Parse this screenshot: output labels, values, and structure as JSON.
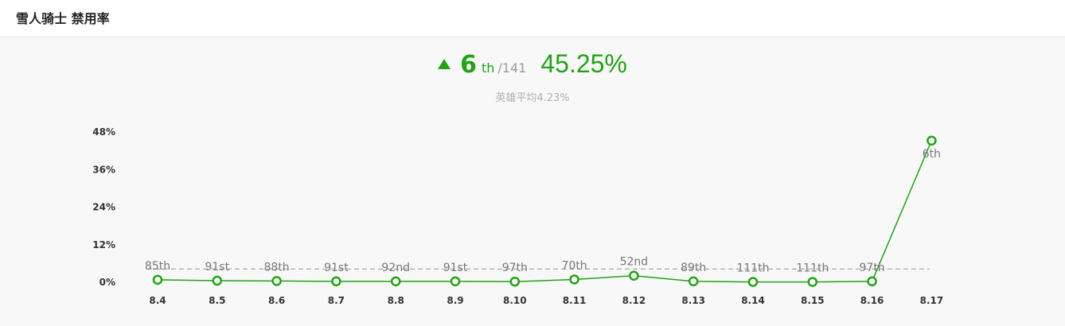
{
  "header": {
    "title": "雪人骑士 禁用率"
  },
  "summary": {
    "rank": "6",
    "rank_suffix": "th",
    "rank_total": "/141",
    "rate": "45.25%",
    "avg_text": "英雄平均4.23%",
    "trend": "up"
  },
  "colors": {
    "accent": "#22a316",
    "avg_line": "#aaaaaa"
  },
  "chart_data": {
    "type": "line",
    "title": "",
    "xlabel": "",
    "ylabel": "",
    "categories": [
      "8.4",
      "8.5",
      "8.6",
      "8.7",
      "8.8",
      "8.9",
      "8.10",
      "8.11",
      "8.12",
      "8.13",
      "8.14",
      "8.15",
      "8.16",
      "8.17"
    ],
    "series": [
      {
        "values": [
          0.8,
          0.5,
          0.4,
          0.3,
          0.3,
          0.3,
          0.2,
          0.9,
          2.1,
          0.3,
          0.1,
          0.1,
          0.3,
          45.25
        ]
      }
    ],
    "point_labels": [
      "85th",
      "91st",
      "88th",
      "91st",
      "92nd",
      "91st",
      "97th",
      "70th",
      "52nd",
      "89th",
      "111th",
      "111th",
      "97th",
      "6th"
    ],
    "average": 4.23,
    "yticks": [
      "0%",
      "12%",
      "24%",
      "36%",
      "48%"
    ],
    "ylim": [
      0,
      48
    ],
    "grid": false,
    "legend": "none"
  }
}
